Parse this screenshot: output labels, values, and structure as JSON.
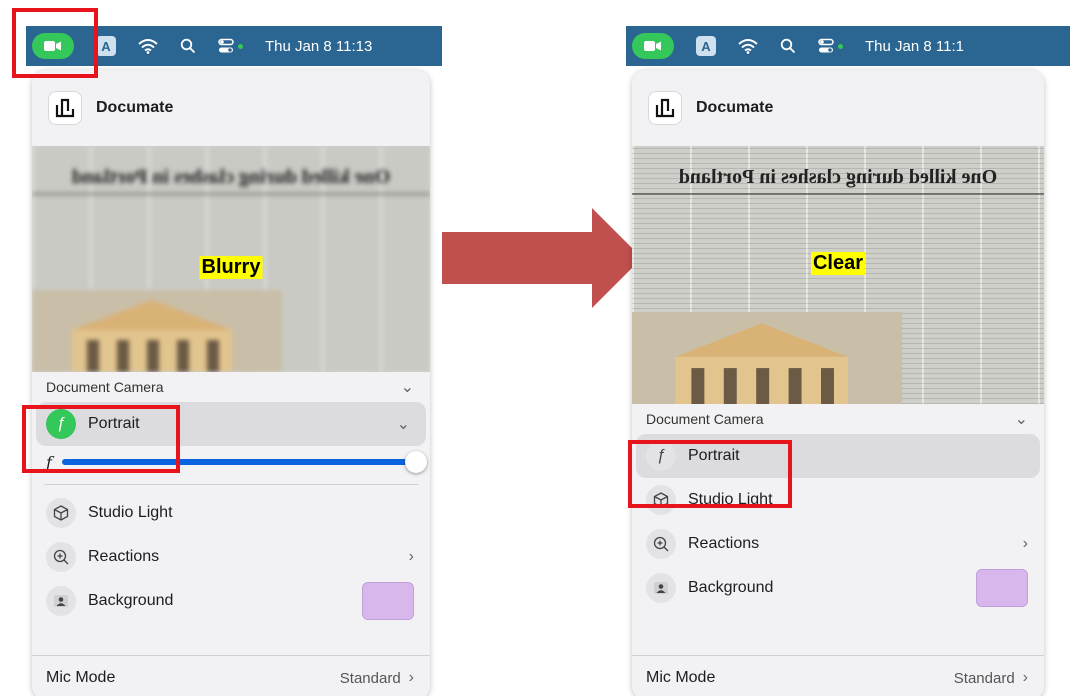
{
  "colors": {
    "menubar": "#2b6591",
    "camera_active": "#34c759",
    "highlight_box": "#e8141c",
    "label_highlight": "#ffff00",
    "arrow": "#c0504d",
    "slider_fill": "#0a64e0",
    "background_swatch": "#d8b8ec"
  },
  "left": {
    "menubar": {
      "datetime": "Thu Jan 8  11:13",
      "input_badge": "A"
    },
    "app_name": "Documate",
    "preview": {
      "headline": "One killed during clashes in Portland",
      "label": "Blurry"
    },
    "section_label": "Document Camera",
    "portrait_label": "Portrait",
    "blur_slider_symbol": "ƒ",
    "blur_slider_value": 1.0,
    "studio_light_label": "Studio Light",
    "reactions_label": "Reactions",
    "background_label": "Background",
    "mic_mode_label": "Mic Mode",
    "mic_mode_value": "Standard"
  },
  "right": {
    "menubar": {
      "datetime": "Thu Jan 8  11:1",
      "input_badge": "A"
    },
    "app_name": "Documate",
    "preview": {
      "headline": "One killed during clashes in Portland",
      "label": "Clear"
    },
    "section_label": "Document Camera",
    "portrait_label": "Portrait",
    "studio_light_label": "Studio Light",
    "reactions_label": "Reactions",
    "background_label": "Background",
    "mic_mode_label": "Mic Mode",
    "mic_mode_value": "Standard"
  },
  "icons": {
    "menubar": [
      "video-camera-icon",
      "input-source-icon",
      "wifi-icon",
      "search-icon",
      "control-center-icon"
    ],
    "rows": [
      "portrait-f-icon",
      "studio-light-cube-icon",
      "reactions-plus-icon",
      "background-person-icon"
    ]
  }
}
